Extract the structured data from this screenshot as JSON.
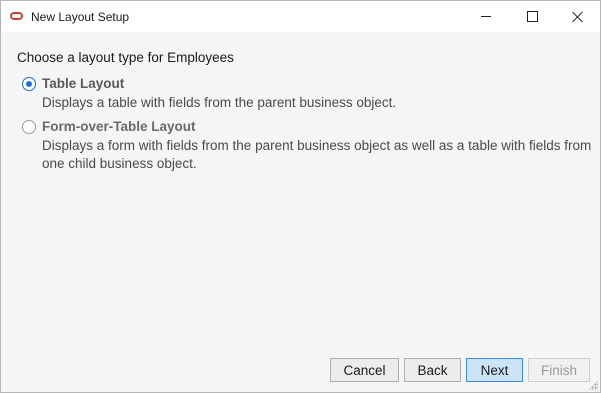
{
  "window": {
    "title": "New Layout Setup",
    "icon": "oracle-app-icon",
    "controls": [
      "minimize-icon",
      "maximize-icon",
      "close-icon"
    ]
  },
  "prompt": "Choose a layout type for Employees",
  "options": [
    {
      "label": "Table Layout",
      "description": "Displays a table with fields from the parent business object.",
      "selected": true
    },
    {
      "label": "Form-over-Table Layout",
      "description": "Displays a form with fields from the parent business object as well as a table with fields from one child business object.",
      "selected": false
    }
  ],
  "buttons": {
    "cancel": "Cancel",
    "back": "Back",
    "next": "Next",
    "finish": "Finish"
  },
  "colors": {
    "accent": "#1f6fd1",
    "brand": "#c74634"
  }
}
